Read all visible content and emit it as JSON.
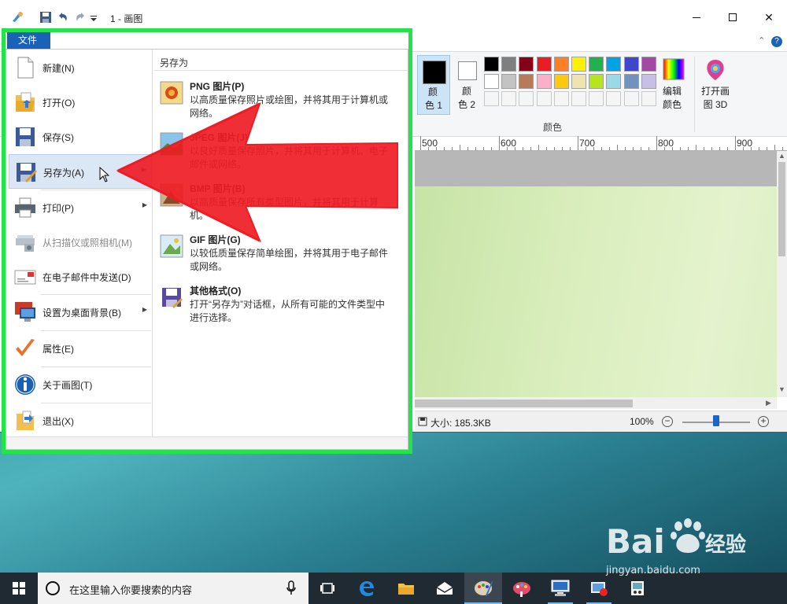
{
  "window": {
    "title": "1 - 画图"
  },
  "ribbon": {
    "color1_label": "颜\n色 1",
    "color1_l1": "颜",
    "color1_l2": "色 1",
    "color2_l1": "颜",
    "color2_l2": "色 2",
    "edit_colors_l1": "编辑",
    "edit_colors_l2": "颜色",
    "paint3d_l1": "打开画",
    "paint3d_l2": "图 3D",
    "group_colors": "颜色",
    "color1_value": "#000000",
    "color2_value": "#ffffff",
    "palette": [
      "#000000",
      "#7f7f7f",
      "#880015",
      "#ed1c24",
      "#ff7f27",
      "#fff200",
      "#22b14c",
      "#00a2e8",
      "#3f48cc",
      "#a349a4",
      "#ffffff",
      "#c3c3c3",
      "#b97a57",
      "#ffaec9",
      "#ffc90e",
      "#efe4b0",
      "#b5e61d",
      "#99d9ea",
      "#7092be",
      "#c8bfe7",
      "#f5f5f5",
      "#f5f5f5",
      "#f5f5f5",
      "#f5f5f5",
      "#f5f5f5",
      "#f5f5f5",
      "#f5f5f5",
      "#f5f5f5",
      "#f5f5f5",
      "#f5f5f5"
    ]
  },
  "ruler": {
    "labels": [
      "500",
      "600",
      "700",
      "800",
      "900"
    ]
  },
  "status": {
    "size": "大小: 185.3KB",
    "zoom": "100%",
    "zoom_level": 0.5
  },
  "file_menu": {
    "tab_label": "文件",
    "items": [
      {
        "label": "新建(N)",
        "icon": "new-document-icon",
        "arrow": false
      },
      {
        "label": "打开(O)",
        "icon": "open-folder-icon",
        "arrow": false
      },
      {
        "label": "保存(S)",
        "icon": "save-icon",
        "arrow": false
      },
      {
        "label": "另存为(A)",
        "icon": "save-as-icon",
        "arrow": true
      },
      {
        "label": "打印(P)",
        "icon": "printer-icon",
        "arrow": true
      },
      {
        "label": "从扫描仪或照相机(M)",
        "icon": "scanner-icon",
        "arrow": false
      },
      {
        "label": "在电子邮件中发送(D)",
        "icon": "email-icon",
        "arrow": false
      },
      {
        "label": "设置为桌面背景(B)",
        "icon": "desktop-background-icon",
        "arrow": true
      },
      {
        "label": "属性(E)",
        "icon": "checkmark-icon",
        "arrow": false
      },
      {
        "label": "关于画图(T)",
        "icon": "info-icon",
        "arrow": false
      },
      {
        "label": "退出(X)",
        "icon": "exit-icon",
        "arrow": false
      }
    ],
    "save_as": {
      "header": "另存为",
      "formats": [
        {
          "title": "PNG 图片(P)",
          "desc": "以高质量保存照片或绘图，并将其用于计算机或网络。",
          "icon": "png-icon"
        },
        {
          "title": "JPEG 图片(J)",
          "desc": "以良好质量保存照片，并将其用于计算机、电子邮件或网络。",
          "icon": "jpeg-icon"
        },
        {
          "title": "BMP 图片(B)",
          "desc": "以高质量保存所有类型图片，并将其用于计算机。",
          "icon": "bmp-icon"
        },
        {
          "title": "GIF 图片(G)",
          "desc": "以较低质量保存简单绘图，并将其用于电子邮件或网络。",
          "icon": "gif-icon"
        },
        {
          "title": "其他格式(O)",
          "desc": "打开“另存为”对话框，从所有可能的文件类型中进行选择。",
          "icon": "other-formats-icon"
        }
      ]
    }
  },
  "taskbar": {
    "search_placeholder": "在这里输入你要搜索的内容"
  },
  "watermark": {
    "brand": "Bai 经验",
    "url": "jingyan.baidu.com"
  },
  "colors": {
    "highlight_border": "#22e34a",
    "file_tab": "#1a62b8",
    "annotation_arrow": "#ee1c25",
    "taskbar": "#1f2a33"
  }
}
